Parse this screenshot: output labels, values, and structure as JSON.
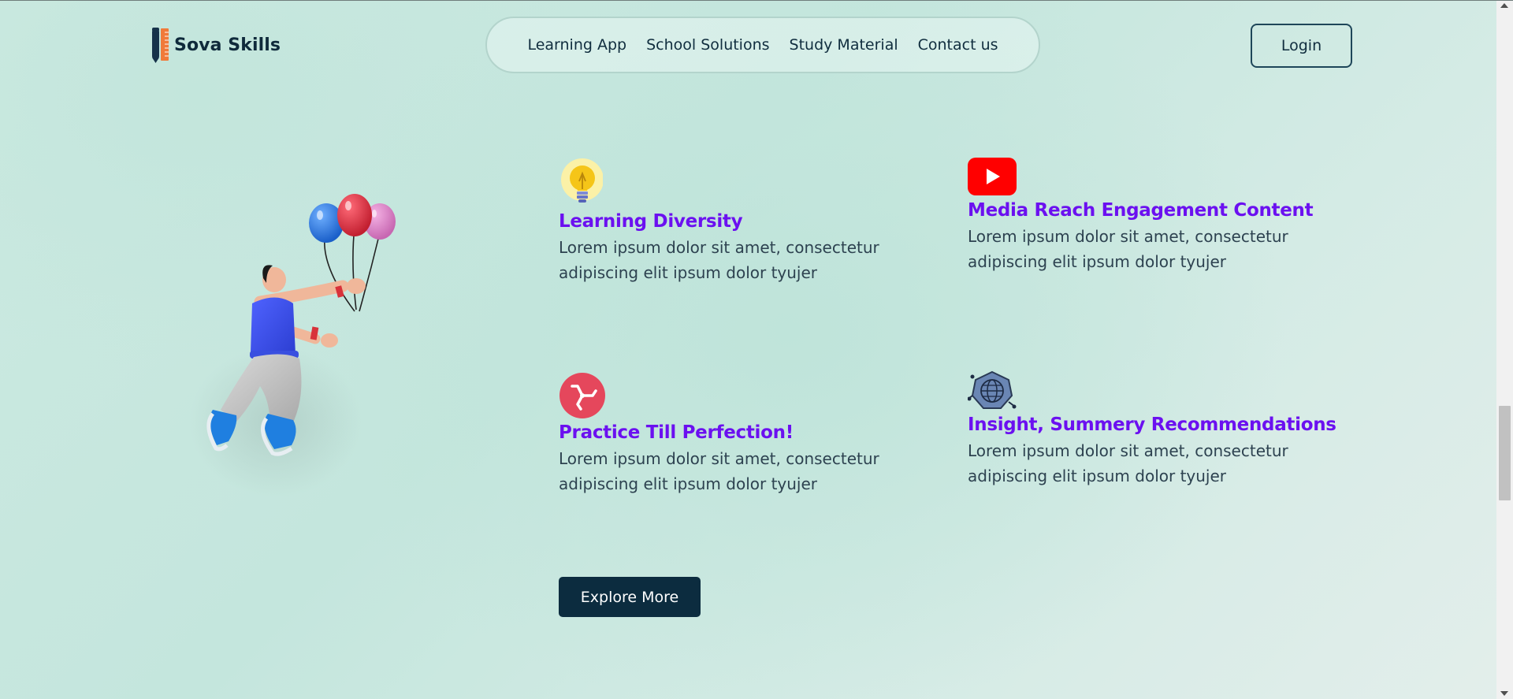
{
  "brand": {
    "name": "Sova Skills",
    "logo_icon": "pencil-ruler-icon"
  },
  "nav": {
    "items": [
      {
        "label": "Learning App"
      },
      {
        "label": "School Solutions"
      },
      {
        "label": "Study Material"
      },
      {
        "label": "Contact us"
      }
    ]
  },
  "header": {
    "login_label": "Login"
  },
  "hero": {
    "illustration": "man-with-balloons-illustration"
  },
  "features": [
    {
      "icon": "lightbulb-icon",
      "title": "Learning Diversity",
      "description": "Lorem ipsum dolor sit amet, consectetur adipiscing elit ipsum dolor tyujer"
    },
    {
      "icon": "youtube-play-icon",
      "title": "Media Reach Engagement Content",
      "description": "Lorem ipsum dolor sit amet, consectetur adipiscing elit ipsum dolor tyujer"
    },
    {
      "icon": "triskelion-icon",
      "title": "Practice Till Perfection!",
      "description": "Lorem ipsum dolor sit amet, consectetur adipiscing elit ipsum dolor tyujer"
    },
    {
      "icon": "globe-network-icon",
      "title": "Insight, Summery Recommendations",
      "description": "Lorem ipsum dolor sit amet, consectetur adipiscing elit ipsum dolor tyujer"
    }
  ],
  "cta": {
    "explore_label": "Explore More"
  },
  "colors": {
    "accent_title": "#6b10f0",
    "dark_navy": "#0c2c3f",
    "background": "#c4e6dd"
  }
}
